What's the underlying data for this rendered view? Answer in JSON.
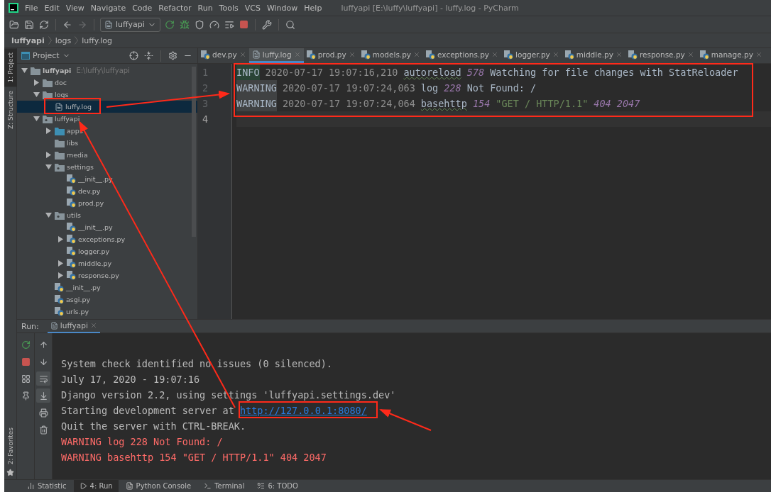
{
  "window": {
    "title": "luffyapi [E:\\luffy\\luffyapi] - luffy.log - PyCharm"
  },
  "menu": [
    "File",
    "Edit",
    "View",
    "Navigate",
    "Code",
    "Refactor",
    "Run",
    "Tools",
    "VCS",
    "Window",
    "Help"
  ],
  "toolbar": {
    "run_config": "luffyapi"
  },
  "breadcrumb": [
    "luffyapi",
    "logs",
    "luffy.log"
  ],
  "left_stripe": [
    {
      "label": "1: Project",
      "selected": true
    },
    {
      "label": "Z: Structure",
      "selected": false
    }
  ],
  "project": {
    "title": "Project",
    "tree": [
      {
        "name": "luffyapi",
        "hint": "E:\\luffy\\luffyapi",
        "kind": "folder",
        "expanded": true,
        "selected": false,
        "children": [
          {
            "name": "doc",
            "kind": "folder",
            "expanded": false,
            "selected": false
          },
          {
            "name": "logs",
            "kind": "folder",
            "expanded": true,
            "selected": false,
            "children": [
              {
                "name": "luffy.log",
                "kind": "log",
                "selected": true
              }
            ]
          },
          {
            "name": "luffyapi",
            "kind": "package",
            "expanded": true,
            "selected": false,
            "children": [
              {
                "name": "apps",
                "kind": "source",
                "expanded": false,
                "selected": false
              },
              {
                "name": "libs",
                "kind": "folder",
                "selected": false
              },
              {
                "name": "media",
                "kind": "folder",
                "expanded": false,
                "selected": false
              },
              {
                "name": "settings",
                "kind": "package",
                "expanded": true,
                "selected": false,
                "children": [
                  {
                    "name": "__init__.py",
                    "kind": "py",
                    "selected": false
                  },
                  {
                    "name": "dev.py",
                    "kind": "py",
                    "selected": false
                  },
                  {
                    "name": "prod.py",
                    "kind": "py",
                    "selected": false
                  }
                ]
              },
              {
                "name": "utils",
                "kind": "package",
                "expanded": true,
                "selected": false,
                "children": [
                  {
                    "name": "__init__.py",
                    "kind": "py",
                    "selected": false
                  },
                  {
                    "name": "exceptions.py",
                    "kind": "py",
                    "expanded": false,
                    "selected": false
                  },
                  {
                    "name": "logger.py",
                    "kind": "py",
                    "selected": false
                  },
                  {
                    "name": "middle.py",
                    "kind": "py",
                    "expanded": false,
                    "selected": false
                  },
                  {
                    "name": "response.py",
                    "kind": "py",
                    "expanded": false,
                    "selected": false
                  }
                ]
              },
              {
                "name": "__init__.py",
                "kind": "py",
                "selected": false
              },
              {
                "name": "asgi.py",
                "kind": "py",
                "selected": false
              },
              {
                "name": "urls.py",
                "kind": "py",
                "selected": false
              }
            ]
          }
        ]
      }
    ]
  },
  "editor": {
    "tabs": [
      {
        "label": "dev.py",
        "kind": "py",
        "selected": false
      },
      {
        "label": "luffy.log",
        "kind": "log",
        "selected": true
      },
      {
        "label": "prod.py",
        "kind": "py",
        "selected": false
      },
      {
        "label": "models.py",
        "kind": "py",
        "selected": false
      },
      {
        "label": "exceptions.py",
        "kind": "py",
        "selected": false
      },
      {
        "label": "logger.py",
        "kind": "py",
        "selected": false
      },
      {
        "label": "middle.py",
        "kind": "py",
        "selected": false
      },
      {
        "label": "response.py",
        "kind": "py",
        "selected": false
      },
      {
        "label": "manage.py",
        "kind": "py",
        "selected": false
      }
    ],
    "lines": [
      {
        "number": "1",
        "current": false,
        "segments": [
          {
            "kind": "info",
            "text": "INFO"
          },
          {
            "kind": "date",
            "text": "2020-07-17 19:07:16,210"
          },
          {
            "kind": "logger",
            "text": "autoreload"
          },
          {
            "kind": "num",
            "text": "578"
          },
          {
            "kind": "text",
            "text": "Watching for file changes with StatReloader"
          }
        ]
      },
      {
        "number": "2",
        "current": false,
        "segments": [
          {
            "kind": "warning",
            "text": "WARNING"
          },
          {
            "kind": "date",
            "text": "2020-07-17 19:07:24,063"
          },
          {
            "kind": "text",
            "text": "log"
          },
          {
            "kind": "num",
            "text": "228"
          },
          {
            "kind": "text",
            "text": "Not Found: /"
          }
        ]
      },
      {
        "number": "3",
        "current": false,
        "segments": [
          {
            "kind": "warning",
            "text": "WARNING"
          },
          {
            "kind": "date",
            "text": "2020-07-17 19:07:24,064"
          },
          {
            "kind": "logger",
            "text": "basehttp"
          },
          {
            "kind": "num",
            "text": "154"
          },
          {
            "kind": "string",
            "text": "\"GET / HTTP/1.1\""
          },
          {
            "kind": "num",
            "text": "404 2047"
          }
        ]
      },
      {
        "number": "4",
        "current": true
      }
    ]
  },
  "run": {
    "label": "Run:",
    "tab": "luffyapi",
    "tools_left": [
      {
        "kind": "rerun"
      },
      {
        "kind": "stop"
      },
      {
        "kind": "layout"
      },
      {
        "kind": "pin"
      }
    ],
    "tools_right": [
      {
        "kind": "up",
        "on": false
      },
      {
        "kind": "down",
        "on": false
      },
      {
        "kind": "wrap",
        "on": true
      },
      {
        "kind": "scroll",
        "on": true
      },
      {
        "kind": "print",
        "on": false
      },
      {
        "kind": "trash",
        "on": false
      }
    ],
    "console": [
      {
        "kind": "normal",
        "segments": [
          {
            "kind": "text",
            "text": "System check identified no issues (0 silenced)."
          }
        ]
      },
      {
        "kind": "normal",
        "segments": [
          {
            "kind": "text",
            "text": "July 17, 2020 - 19:07:16"
          }
        ]
      },
      {
        "kind": "normal",
        "segments": [
          {
            "kind": "text",
            "text": "Django version 2.2, using settings 'luffyapi.settings.dev'"
          }
        ]
      },
      {
        "kind": "normal",
        "segments": [
          {
            "kind": "text",
            "text": "Starting development server at "
          },
          {
            "kind": "link",
            "text": "http://127.0.0.1:8080/"
          }
        ]
      },
      {
        "kind": "normal",
        "segments": [
          {
            "kind": "text",
            "text": "Quit the server with CTRL-BREAK."
          }
        ]
      },
      {
        "kind": "error",
        "segments": [
          {
            "kind": "text",
            "text": "WARNING log 228 Not Found: /"
          }
        ]
      },
      {
        "kind": "error",
        "segments": [
          {
            "kind": "text",
            "text": "WARNING basehttp 154 \"GET / HTTP/1.1\" 404 2047"
          }
        ]
      }
    ]
  },
  "favorites": {
    "label": "2: Favorites"
  },
  "bottom_tabs": [
    {
      "label": "Statistic",
      "kind": "stat",
      "selected": false
    },
    {
      "label": "4: Run",
      "kind": "run",
      "selected": true
    },
    {
      "label": "Python Console",
      "kind": "python",
      "selected": false
    },
    {
      "label": "Terminal",
      "kind": "terminal",
      "selected": false
    },
    {
      "label": "6: TODO",
      "kind": "todo",
      "selected": false
    }
  ]
}
